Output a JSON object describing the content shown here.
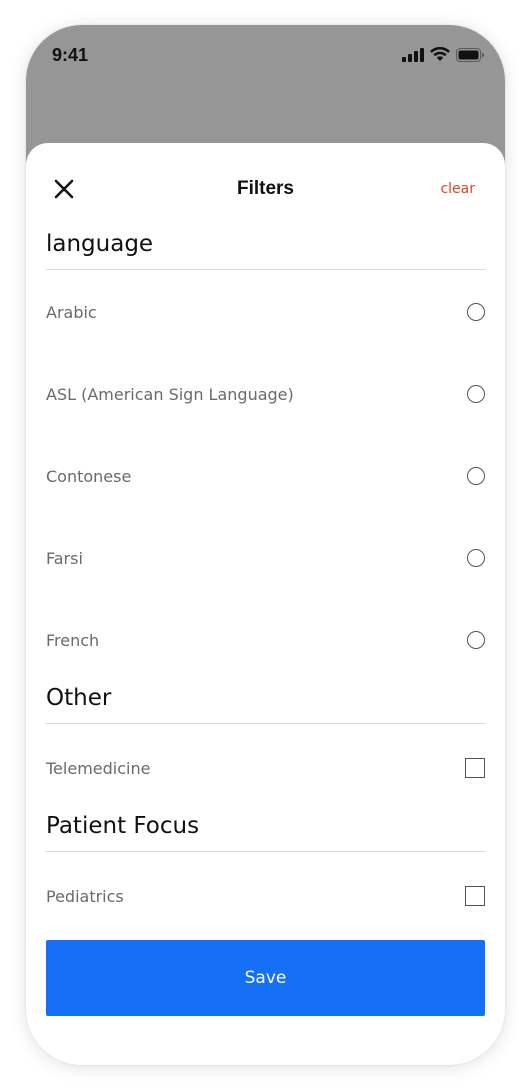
{
  "status_bar": {
    "time": "9:41"
  },
  "header": {
    "close_icon": "close-icon",
    "title": "Filters",
    "clear_label": "clear"
  },
  "sections": {
    "language": {
      "title": "language",
      "options": [
        "Arabic",
        "ASL (American Sign Language)",
        "Contonese",
        "Farsi",
        "French"
      ]
    },
    "other": {
      "title": "Other",
      "options": [
        "Telemedicine"
      ]
    },
    "patient_focus": {
      "title": "Patient Focus",
      "options": [
        "Pediatrics"
      ]
    }
  },
  "save_label": "Save",
  "colors": {
    "accent": "#1570f6",
    "clear": "#e2401f",
    "backdrop": "#969696"
  }
}
